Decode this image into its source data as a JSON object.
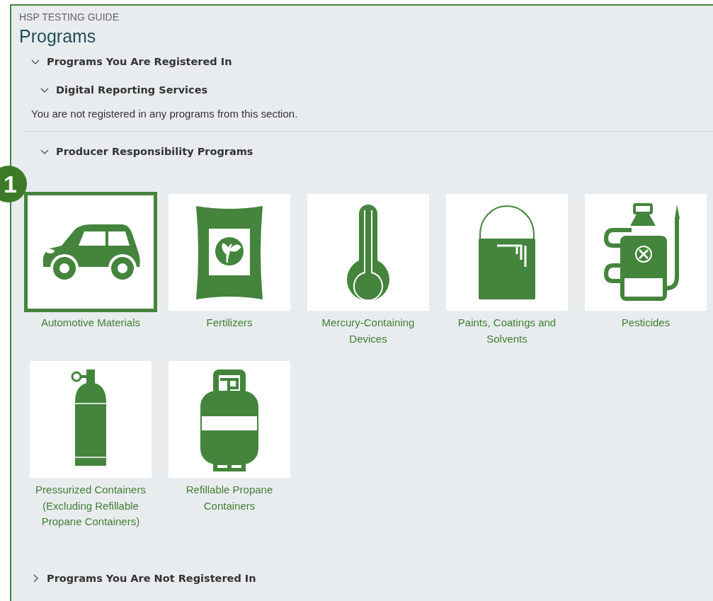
{
  "breadcrumb": "HSP TESTING GUIDE",
  "title": "Programs",
  "callout": {
    "label": "1"
  },
  "sections": [
    {
      "heading": "Programs You Are Registered In",
      "expanded": true,
      "subsections": [
        {
          "heading": "Digital Reporting Services",
          "expanded": true,
          "message": "You are not registered in any programs from this section."
        },
        {
          "heading": "Producer Responsibility Programs",
          "expanded": true,
          "programs": [
            {
              "name": "Automotive Materials",
              "selected": true
            },
            {
              "name": "Fertilizers",
              "selected": false
            },
            {
              "name": "Mercury-Containing Devices",
              "selected": false
            },
            {
              "name": "Paints, Coatings and Solvents",
              "selected": false
            },
            {
              "name": "Pesticides",
              "selected": false
            },
            {
              "name": "Pressurized Containers (Excluding Refillable Propane Containers)",
              "selected": false
            },
            {
              "name": "Refillable Propane Containers",
              "selected": false
            }
          ]
        }
      ]
    },
    {
      "heading": "Programs You Are Not Registered In",
      "expanded": false
    }
  ]
}
